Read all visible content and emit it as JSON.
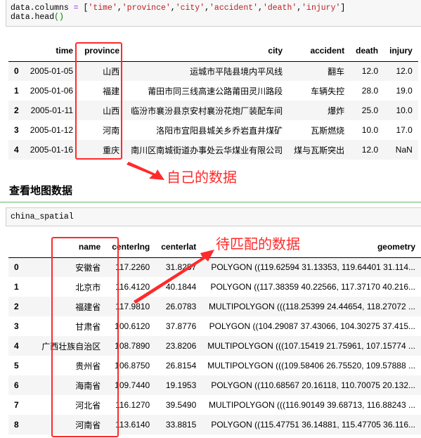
{
  "cell1": {
    "line1_prefix": "data.columns ",
    "line1_op": "=",
    "line1_open": " [",
    "columns": [
      "'time'",
      "'province'",
      "'city'",
      "'accident'",
      "'death'",
      "'injury'"
    ],
    "line1_close": "]",
    "line2_name": "data.head",
    "line2_parens": "()"
  },
  "df1": {
    "headers": [
      "",
      "time",
      "province",
      "city",
      "accident",
      "death",
      "injury"
    ],
    "rows": [
      {
        "index": "0",
        "time": "2005-01-05",
        "province": "山西",
        "city": "运城市平陆县境内平风线",
        "accident": "翻车",
        "death": "12.0",
        "injury": "12.0"
      },
      {
        "index": "1",
        "time": "2005-01-06",
        "province": "福建",
        "city": "莆田市同三线高速公路莆田灵川路段",
        "accident": "车辆失控",
        "death": "28.0",
        "injury": "19.0"
      },
      {
        "index": "2",
        "time": "2005-01-11",
        "province": "山西",
        "city": "临汾市襄汾县京安村襄汾花炮厂装配车间",
        "accident": "爆炸",
        "death": "25.0",
        "injury": "10.0"
      },
      {
        "index": "3",
        "time": "2005-01-12",
        "province": "河南",
        "city": "洛阳市宜阳县城关乡乔岩直井煤矿",
        "accident": "瓦斯燃烧",
        "death": "10.0",
        "injury": "17.0"
      },
      {
        "index": "4",
        "time": "2005-01-16",
        "province": "重庆",
        "city": "南川区南城街道办事处云华煤业有限公司",
        "accident": "煤与瓦斯突出",
        "death": "12.0",
        "injury": "NaN"
      }
    ]
  },
  "annotations": {
    "own_data": "自己的数据",
    "to_match": "待匹配的数据",
    "color": "#ff2a2a"
  },
  "section_heading": "查看地图数据",
  "cell2": {
    "code": "china_spatial"
  },
  "df2": {
    "headers": [
      "",
      "name",
      "centerlng",
      "centerlat",
      "geometry"
    ],
    "rows": [
      {
        "index": "0",
        "name": "安徽省",
        "centerlng": "117.2260",
        "centerlat": "31.8257",
        "geometry": "POLYGON ((119.62594 31.13353, 119.64401 31.114..."
      },
      {
        "index": "1",
        "name": "北京市",
        "centerlng": "116.4120",
        "centerlat": "40.1844",
        "geometry": "POLYGON ((117.38359 40.22566, 117.37170 40.216..."
      },
      {
        "index": "2",
        "name": "福建省",
        "centerlng": "117.9810",
        "centerlat": "26.0783",
        "geometry": "MULTIPOLYGON (((118.25399 24.44654, 118.27072 ..."
      },
      {
        "index": "3",
        "name": "甘肃省",
        "centerlng": "100.6120",
        "centerlat": "37.8776",
        "geometry": "POLYGON ((104.29087 37.43066, 104.30275 37.415..."
      },
      {
        "index": "4",
        "name": "广西壮族自治区",
        "centerlng": "108.7890",
        "centerlat": "23.8206",
        "geometry": "MULTIPOLYGON (((107.15419 21.75961, 107.15774 ..."
      },
      {
        "index": "5",
        "name": "贵州省",
        "centerlng": "106.8750",
        "centerlat": "26.8154",
        "geometry": "MULTIPOLYGON (((109.58406 26.75520, 109.57888 ..."
      },
      {
        "index": "6",
        "name": "海南省",
        "centerlng": "109.7440",
        "centerlat": "19.1953",
        "geometry": "POLYGON ((110.68567 20.16118, 110.70075 20.132..."
      },
      {
        "index": "7",
        "name": "河北省",
        "centerlng": "116.1270",
        "centerlat": "39.5490",
        "geometry": "MULTIPOLYGON (((116.90149 39.68713, 116.88243 ..."
      },
      {
        "index": "8",
        "name": "河南省",
        "centerlng": "113.6140",
        "centerlat": "33.8815",
        "geometry": "POLYGON ((115.47751 36.14881, 115.47705 36.116..."
      }
    ]
  }
}
